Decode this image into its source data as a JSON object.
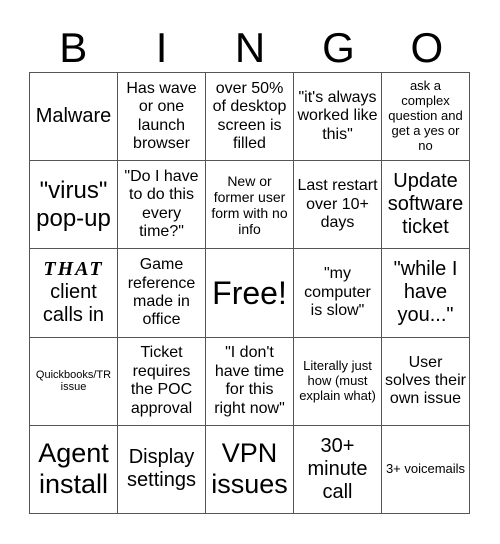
{
  "header": {
    "letters": [
      "B",
      "I",
      "N",
      "G",
      "O"
    ]
  },
  "cells": [
    [
      "Malware",
      "Has wave or one launch browser",
      "over 50% of desktop screen is filled",
      "\"it's always worked like this\"",
      "ask a complex question and get a yes or no"
    ],
    [
      "\"virus\" pop-up",
      "\"Do I have to do this every time?\"",
      "New or former user form with no info",
      "Last restart over 10+ days",
      "Update software ticket"
    ],
    [
      {
        "emphasis": "THAT",
        "text": "client calls in"
      },
      "Game reference made in office",
      "Free!",
      "\"my computer is slow\"",
      "\"while I have you...\""
    ],
    [
      "Quickbooks/TR issue",
      "Ticket requires the POC approval",
      "\"I don't have time for this right now\"",
      "Literally just how (must explain what)",
      "User solves their own issue"
    ],
    [
      "Agent install",
      "Display settings",
      "VPN issues",
      "30+ minute call",
      "3+ voicemails"
    ]
  ]
}
